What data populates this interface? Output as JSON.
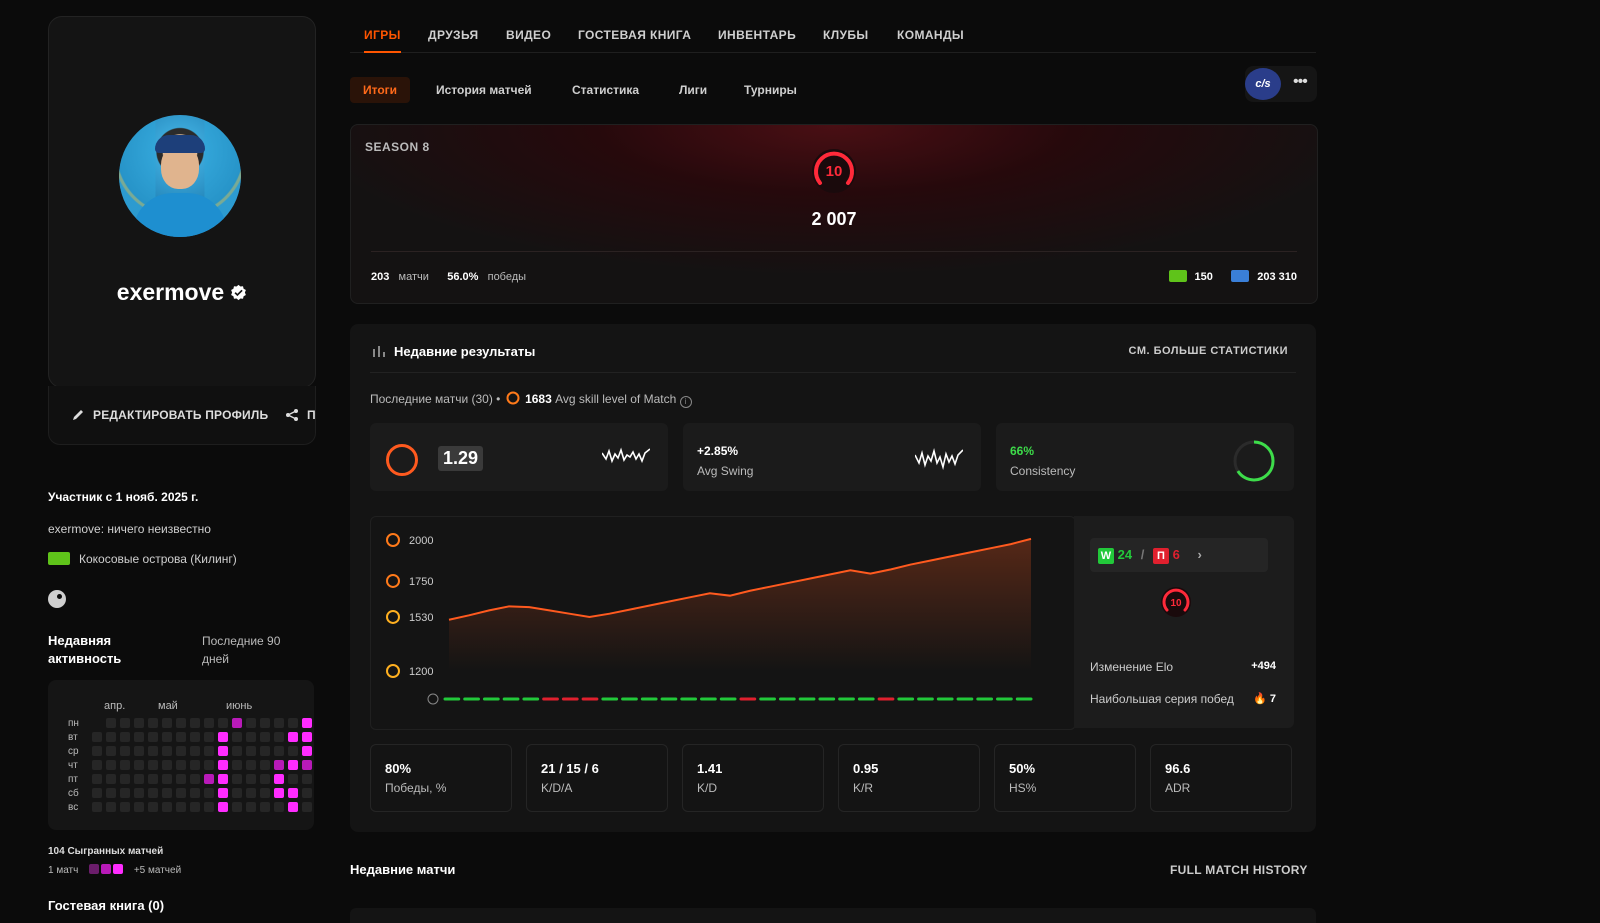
{
  "profile": {
    "username": "exermove",
    "edit_label": "РЕДАКТИРОВАТЬ ПРОФИЛЬ",
    "share_label": "ПОДЕЛИТЬСЯ",
    "member_since": "Участник с 1 нояб. 2025 г.",
    "bio": "exermove: ничего неизвестно",
    "location": "Кокосовые острова (Килинг)"
  },
  "activity": {
    "title": "Недавняя активность",
    "range": "Последние 90 дней",
    "months": [
      "апр.",
      "май",
      "июнь"
    ],
    "days": [
      "пн",
      "вт",
      "ср",
      "чт",
      "пт",
      "сб",
      "вс"
    ],
    "played": "104 Сыгранных матчей",
    "legend_min": "1 матч",
    "legend_max": "+5 матчей"
  },
  "guestbook": "Гостевая книга (0)",
  "top_tabs": [
    "ИГРЫ",
    "ДРУЗЬЯ",
    "ВИДЕО",
    "ГОСТЕВАЯ КНИГА",
    "ИНВЕНТАРЬ",
    "КЛУБЫ",
    "КОМАНДЫ"
  ],
  "sub_tabs": [
    "Итоги",
    "История матчей",
    "Статистика",
    "Лиги",
    "Турниры"
  ],
  "game": {
    "logo": "c/s",
    "more": "•••"
  },
  "season": {
    "label": "SEASON 8",
    "level": "10",
    "elo": "2 007",
    "matches_value": "203",
    "matches_label": "матчи",
    "wins_value": "56.0%",
    "wins_label": "победы",
    "points_a": "150",
    "points_b": "203 310"
  },
  "results": {
    "title": "Недавние результаты",
    "see_more": "СМ. БОЛЬШЕ СТАТИСТИКИ",
    "last_matches": "Последние матчи (30)",
    "skill_value": "1683",
    "skill_label": "Avg skill level of Match",
    "rating": "1.29",
    "swing_value": "+2.85%",
    "swing_label": "Avg Swing",
    "consistency_value": "66%",
    "consistency_label": "Consistency",
    "consistency_fraction": 0.66,
    "wins": "24",
    "losses": "6",
    "win_tag": "W",
    "loss_tag": "П",
    "level": "10",
    "elo_change_label": "Изменение Elo",
    "elo_change_value": "+494",
    "streak_label": "Наибольшая серия побед",
    "streak_value": "7",
    "stats": [
      {
        "value": "80%",
        "label": "Победы, %"
      },
      {
        "value": "21 / 15 / 6",
        "label": "K/D/A"
      },
      {
        "value": "1.41",
        "label": "K/D"
      },
      {
        "value": "0.95",
        "label": "K/R"
      },
      {
        "value": "50%",
        "label": "HS%"
      },
      {
        "value": "96.6",
        "label": "ADR"
      }
    ]
  },
  "chart_data": {
    "type": "area",
    "y_ticks": [
      2000,
      1750,
      1530,
      1200
    ],
    "ylim": [
      1200,
      2000
    ],
    "values": [
      1513,
      1540,
      1570,
      1595,
      1590,
      1570,
      1550,
      1530,
      1550,
      1575,
      1600,
      1625,
      1650,
      1675,
      1660,
      1690,
      1715,
      1740,
      1765,
      1790,
      1815,
      1795,
      1820,
      1850,
      1875,
      1900,
      1925,
      1950,
      1975,
      2007
    ],
    "results": [
      "W",
      "W",
      "W",
      "W",
      "W",
      "L",
      "L",
      "L",
      "W",
      "W",
      "W",
      "W",
      "W",
      "W",
      "W",
      "L",
      "W",
      "W",
      "W",
      "W",
      "W",
      "W",
      "L",
      "W",
      "W",
      "W",
      "W",
      "W",
      "W",
      "W"
    ],
    "colors": {
      "line": "#ff5a1f",
      "win": "#22c93a",
      "loss": "#e0202e"
    }
  },
  "recent_matches": "Недавние матчи",
  "full_history": "FULL MATCH HISTORY"
}
